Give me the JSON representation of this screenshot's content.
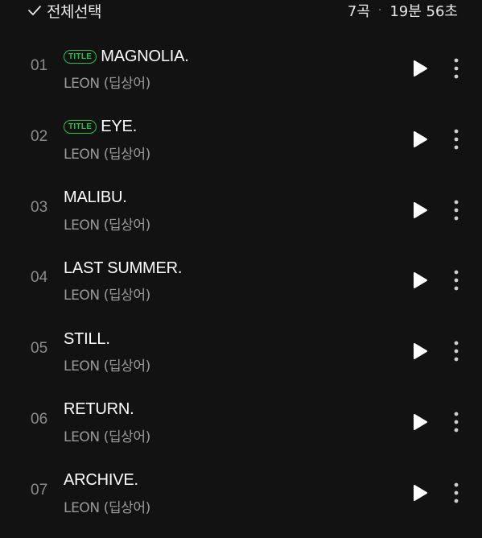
{
  "header": {
    "select_all_label": "전체선택",
    "track_count": "7곡",
    "separator": "·",
    "total_duration": "19분 56초"
  },
  "colors": {
    "background": "#121212",
    "accent_green": "#27c24c",
    "text_primary": "#ffffff",
    "text_secondary": "#9a9a9a"
  },
  "tracks": [
    {
      "number": "01",
      "badge": "TITLE",
      "title": "MAGNOLIA.",
      "artist": "LEON (딥상어)"
    },
    {
      "number": "02",
      "badge": "TITLE",
      "title": "EYE.",
      "artist": "LEON (딥상어)"
    },
    {
      "number": "03",
      "badge": "",
      "title": "MALIBU.",
      "artist": "LEON (딥상어)"
    },
    {
      "number": "04",
      "badge": "",
      "title": "LAST SUMMER.",
      "artist": "LEON (딥상어)"
    },
    {
      "number": "05",
      "badge": "",
      "title": "STILL.",
      "artist": "LEON (딥상어)"
    },
    {
      "number": "06",
      "badge": "",
      "title": "RETURN.",
      "artist": "LEON (딥상어)"
    },
    {
      "number": "07",
      "badge": "",
      "title": "ARCHIVE.",
      "artist": "LEON (딥상어)"
    }
  ],
  "icons": {
    "select_all": "check-icon",
    "play": "play-icon",
    "more": "more-vertical-icon"
  }
}
